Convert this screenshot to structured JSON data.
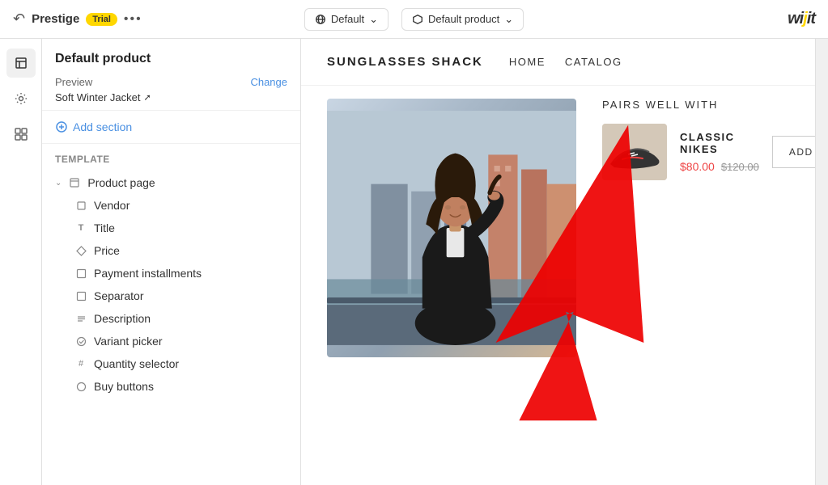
{
  "topbar": {
    "app_name": "Prestige",
    "trial_label": "Trial",
    "more_label": "...",
    "center_left": "Default",
    "center_right": "Default product",
    "logo": "wijit"
  },
  "left_panel": {
    "title": "Default product",
    "preview_label": "Preview",
    "change_label": "Change",
    "preview_product": "Soft Winter Jacket",
    "add_section_label": "Add section",
    "template_label": "Template",
    "tree": {
      "product_page": "Product page",
      "vendor": "Vendor",
      "title": "Title",
      "price": "Price",
      "payment_installments": "Payment installments",
      "separator": "Separator",
      "description": "Description",
      "variant_picker": "Variant picker",
      "quantity_selector": "Quantity selector",
      "buy_buttons": "Buy buttons"
    }
  },
  "store": {
    "brand": "SUNGLASSES SHACK",
    "nav": [
      "HOME",
      "CATALOG"
    ],
    "pairs_well_title": "PAIRS WELL WITH",
    "product_name": "CLASSIC NIKES",
    "price_new": "$80.00",
    "price_old": "$120.00",
    "add_to_cart": "ADD TO CART"
  }
}
